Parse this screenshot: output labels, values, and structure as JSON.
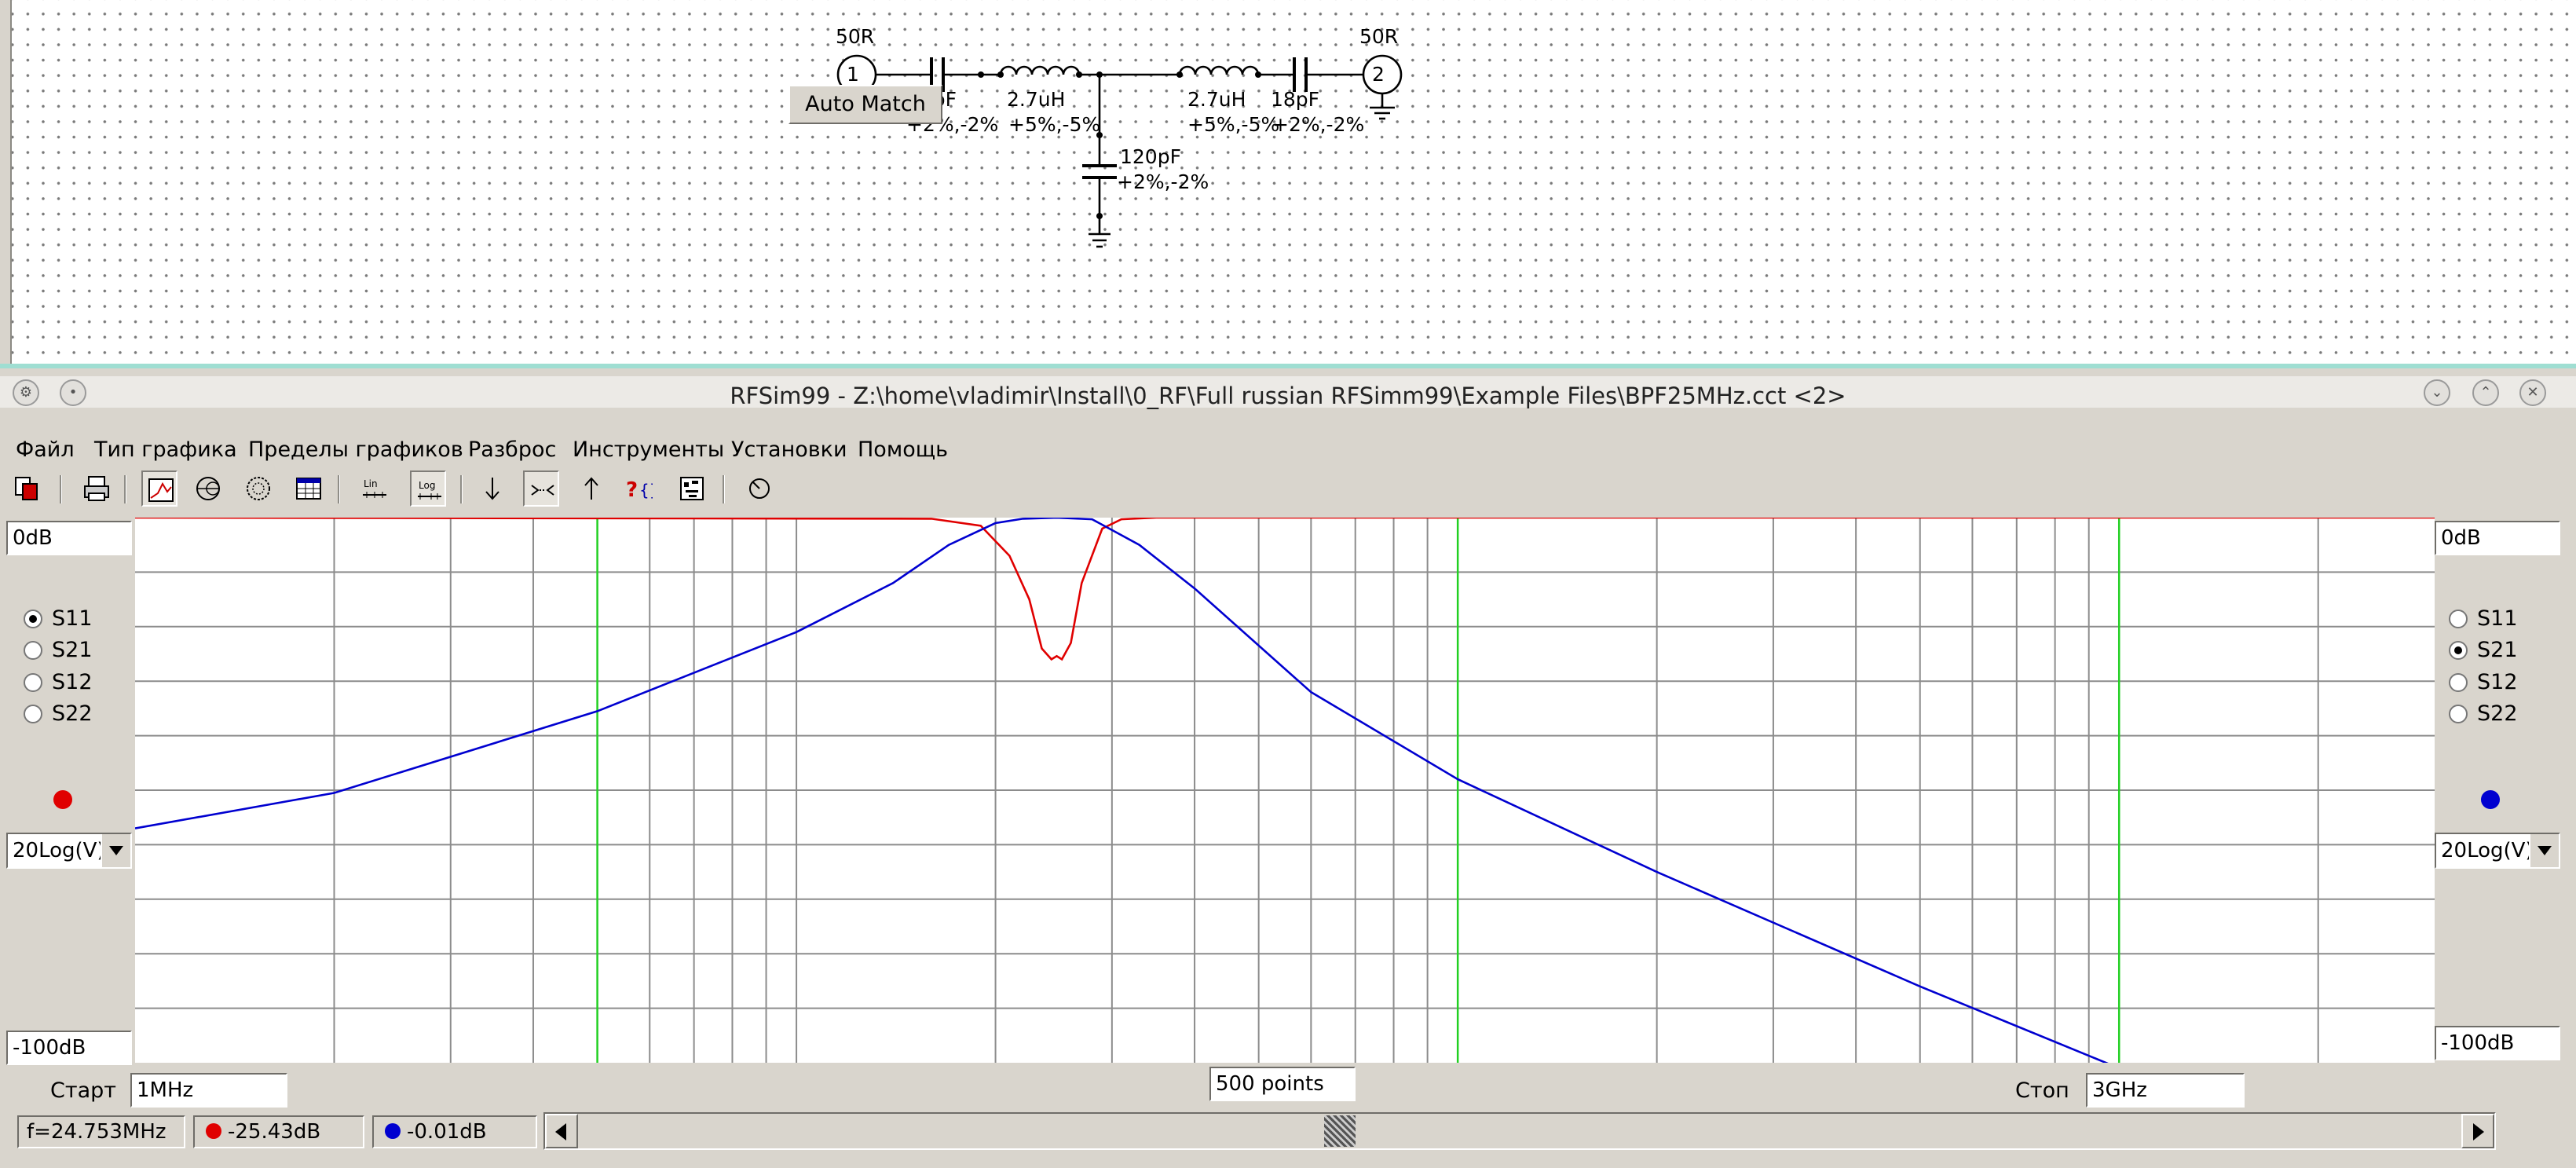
{
  "schematic": {
    "ports": [
      {
        "number": "1",
        "impedance": "50R"
      },
      {
        "number": "2",
        "impedance": "50R"
      }
    ],
    "components": [
      {
        "value": "18pF",
        "tolerance": "+2%,-2%"
      },
      {
        "value": "2.7uH",
        "tolerance": "+5%,-5%"
      },
      {
        "value": "2.7uH",
        "tolerance": "+5%,-5%"
      },
      {
        "value": "18pF",
        "tolerance": "+2%,-2%"
      },
      {
        "value": "120pF",
        "tolerance": "+2%,-2%"
      }
    ]
  },
  "window": {
    "title": "RFSim99 - Z:\\home\\vladimir\\Install\\0_RF\\Full russian RFSimm99\\Example Files\\BPF25MHz.cct <2>"
  },
  "menu": {
    "items": [
      "Файл",
      "Тип графика",
      "Пределы графиков",
      "Разброс",
      "Инструменты",
      "Установки",
      "Помощь"
    ]
  },
  "toolbar": {
    "icons": [
      "copy-icon",
      "print-icon",
      "rect-plot-icon",
      "smith-chart-icon",
      "polar-chart-icon",
      "table-icon",
      "linear-scale-icon",
      "log-scale-icon",
      "marker-down-icon",
      "marker-both-icon",
      "marker-up-icon",
      "help-icon",
      "component-icon",
      "tune-icon"
    ],
    "lin_label": "Lin",
    "log_label": "Log",
    "auto_match_label": "Auto Match"
  },
  "left_panel": {
    "top_value": "0dB",
    "bottom_value": "-100dB",
    "params": [
      "S11",
      "S21",
      "S12",
      "S22"
    ],
    "selected": "S11",
    "trace_color": "#e00000",
    "scale": "20Log(V)"
  },
  "right_panel": {
    "top_value": "0dB",
    "bottom_value": "-100dB",
    "params": [
      "S11",
      "S21",
      "S12",
      "S22"
    ],
    "selected": "S21",
    "trace_color": "#0000d0",
    "scale": "20Log(V)"
  },
  "sweep": {
    "start_label": "Старт",
    "start_value": "1MHz",
    "points": "500 points",
    "stop_label": "Стоп",
    "stop_value": "3GHz"
  },
  "status": {
    "frequency": "f=24.753MHz",
    "s11_value": "-25.43dB",
    "s21_value": "-0.01dB"
  },
  "chart_data": {
    "type": "line",
    "x_scale": "log",
    "x_range_mhz": [
      1,
      3000
    ],
    "y_range_db": [
      -100,
      0
    ],
    "grid": true,
    "y_divisions": 10,
    "x_markers_mhz": [
      5,
      100,
      1000
    ],
    "series": [
      {
        "color": "#e00000",
        "x_mhz": [
          1,
          16,
          19,
          21,
          22.5,
          23.5,
          24.3,
          24.75,
          25.2,
          26,
          27,
          29,
          31,
          35,
          3000
        ],
        "y_db": [
          0,
          -0.2,
          -1.5,
          -7,
          -15,
          -24,
          -26,
          -25.4,
          -26,
          -23,
          -12,
          -2,
          -0.3,
          0,
          0
        ]
      },
      {
        "color": "#0000d0",
        "x_mhz": [
          1,
          2,
          5,
          10,
          14,
          17,
          20,
          22,
          24.75,
          28,
          33,
          40,
          60,
          100,
          200,
          500,
          1000,
          1600
        ],
        "y_db": [
          -57,
          -50.5,
          -35.5,
          -21,
          -12,
          -5,
          -1,
          -0.2,
          -0.01,
          -0.3,
          -5,
          -13,
          -32,
          -48,
          -65,
          -86,
          -101,
          -104
        ]
      }
    ]
  }
}
